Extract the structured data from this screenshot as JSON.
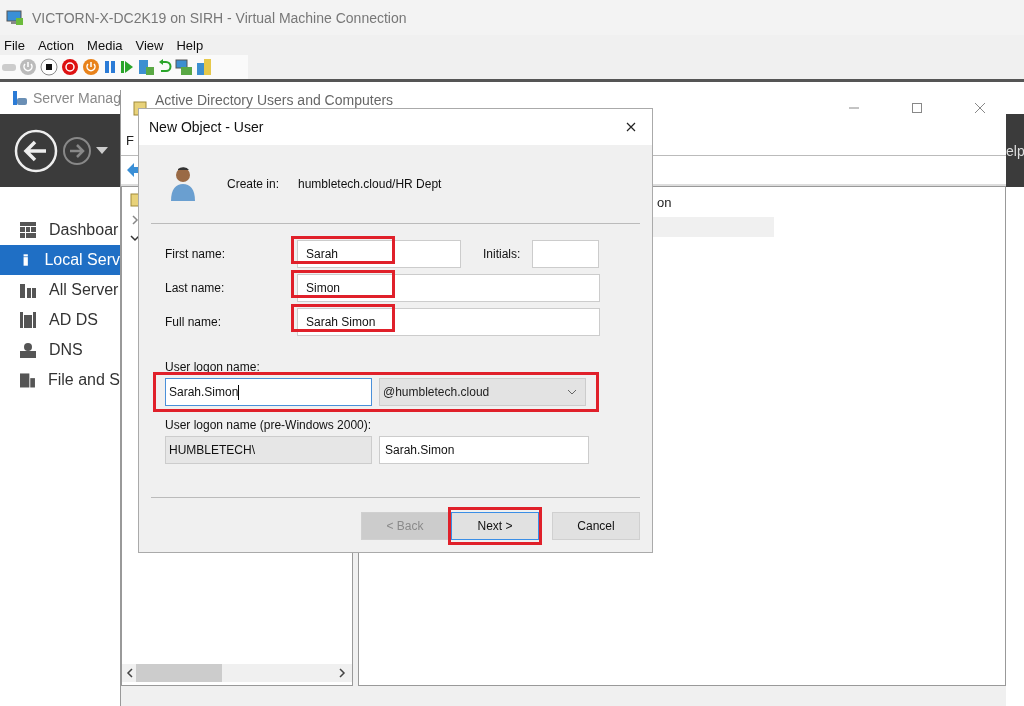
{
  "vm_window": {
    "title": "VICTORN-X-DC2K19 on SIRH - Virtual Machine Connection",
    "menu": [
      "File",
      "Action",
      "Media",
      "View",
      "Help"
    ]
  },
  "server_manager": {
    "title": "Server Manag",
    "header_fragment": "elp",
    "nav": [
      {
        "label": "Dashboar",
        "selected": false
      },
      {
        "label": "Local Serv",
        "selected": true
      },
      {
        "label": "All Server",
        "selected": false
      },
      {
        "label": "AD DS",
        "selected": false
      },
      {
        "label": "DNS",
        "selected": false
      },
      {
        "label": "File and S",
        "selected": false
      }
    ]
  },
  "aduc_window": {
    "title": "Active Directory Users and Computers",
    "menu": [
      "F"
    ],
    "list_fragment": "on"
  },
  "dialog": {
    "title": "New Object - User",
    "create_in_label": "Create in:",
    "create_in_path": "humbletech.cloud/HR Dept",
    "first_name": {
      "label": "First name:",
      "value": "Sarah",
      "highlighted": true
    },
    "initials": {
      "label": "Initials:"
    },
    "last_name": {
      "label": "Last name:",
      "value": "Simon",
      "highlighted": true
    },
    "full_name": {
      "label": "Full name:",
      "value": "Sarah Simon",
      "highlighted": true
    },
    "logon": {
      "label": "User logon name:",
      "value": "Sarah.Simon",
      "focused": true,
      "domain": "@humbletech.cloud",
      "highlighted": true
    },
    "pre2000": {
      "label": "User logon name (pre-Windows 2000):",
      "prefix": "HUMBLETECH\\",
      "value": "Sarah.Simon"
    },
    "buttons": [
      {
        "label": "< Back",
        "disabled": true,
        "default": false,
        "highlighted": false
      },
      {
        "label": "Next >",
        "disabled": false,
        "default": true,
        "highlighted": true
      },
      {
        "label": "Cancel",
        "disabled": false,
        "default": false,
        "highlighted": false
      }
    ]
  }
}
